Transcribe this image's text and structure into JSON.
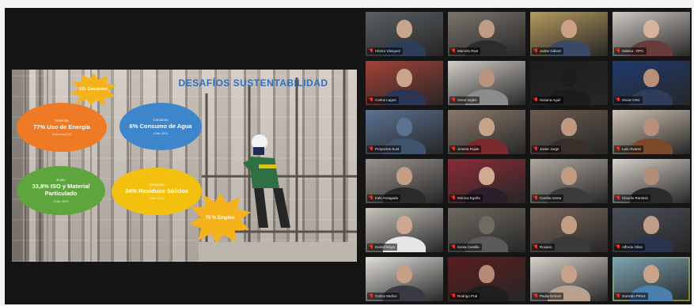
{
  "slide": {
    "title": "DESAFÍOS SUSTENTABILIDAD",
    "bubbles": [
      {
        "id": "orange",
        "cap": "Vivienda",
        "main": "77% Uso de Energía",
        "note": "Consumo (%)"
      },
      {
        "id": "blue",
        "cap": "Consumo",
        "main": "6% Consumo de Agua",
        "note": "Chile 2011"
      },
      {
        "id": "green",
        "cap": "Suelo",
        "main": "33,8% ISO y Material Particulado",
        "note": "Chile 2015"
      },
      {
        "id": "yellow",
        "cap": "Residuos",
        "main": "34% Residuos Sólidos",
        "note": "Chile 2010"
      }
    ],
    "bursts": [
      "CO₂ Emisiones",
      "75 % Empleo"
    ]
  },
  "participants": [
    {
      "name": "Héctor Vásquez",
      "bg": "#5a5f63",
      "skin": "#c9a58c",
      "shirt": "#2d3e5b"
    },
    {
      "name": "Marcelo Rive",
      "bg": "#7b746c",
      "skin": "#c19b84",
      "shirt": "#2c2c2c"
    },
    {
      "name": "Jaime Gálvez",
      "bg": "#b49a5e",
      "skin": "#caa283",
      "shirt": "#3a4a66"
    },
    {
      "name": "Sabina - RPC",
      "bg": "#cfc9c4",
      "skin": "#d7b39c",
      "shirt": "#6a3b3b"
    },
    {
      "name": "Carlos Lagos",
      "bg": "#a44236",
      "skin": "#c9a58a",
      "shirt": "#2b3556"
    },
    {
      "name": "Omar Ingles",
      "bg": "#d2cdc7",
      "skin": "#b9957f",
      "shirt": "#8c8c8c"
    },
    {
      "name": "Susana Aguir",
      "bg": "#1c1c1c",
      "skin": "#1c1c1c",
      "shirt": "#1c1c1c"
    },
    {
      "name": "Oscar Ortiz",
      "bg": "#203a70",
      "skin": "#b88f79",
      "shirt": "#2f3d5a"
    },
    {
      "name": "Proyectos Sust",
      "bg": "#5b7392",
      "skin": "#5b7392",
      "shirt": "#40536d"
    },
    {
      "name": "Jimena Rojas",
      "bg": "#8b7a6c",
      "skin": "#c8a189",
      "shirt": "#7a2a2a"
    },
    {
      "name": "Javier Jorgs",
      "bg": "#6d5c50",
      "skin": "#bf9880",
      "shirt": "#3a2e2a"
    },
    {
      "name": "Luis Alvarez",
      "bg": "#cfc3b2",
      "skin": "#b88f7a",
      "shirt": "#7a4a2a"
    },
    {
      "name": "Inés Arriagada",
      "bg": "#9a948f",
      "skin": "#c59e86",
      "shirt": "#2a2a2a"
    },
    {
      "name": "Mónica Egaña",
      "bg": "#8a2c36",
      "skin": "#d0ab91",
      "shirt": "#2a1f2a"
    },
    {
      "name": "Camila Arena",
      "bg": "#b1a9a0",
      "skin": "#c29a83",
      "shirt": "#3b3b3b"
    },
    {
      "name": "Claudio Ramirez",
      "bg": "#d6d1ca",
      "skin": "#b38d78",
      "shirt": "#2a2a2a"
    },
    {
      "name": "Daniel Moya",
      "bg": "#c8c3bd",
      "skin": "#cda78e",
      "shirt": "#e6e6e6"
    },
    {
      "name": "Sonia Castillo",
      "bg": "#6f6a62",
      "skin": "#6f6a62",
      "shirt": "#5a5a5a"
    },
    {
      "name": "Rosario",
      "bg": "#7d6a5e",
      "skin": "#c69d84",
      "shirt": "#3a3a3a"
    },
    {
      "name": "Alfredo Oliva",
      "bg": "#4a4f58",
      "skin": "#c19c86",
      "shirt": "#2a3450"
    },
    {
      "name": "Carlos Muñoz",
      "bg": "#e2dfda",
      "skin": "#c7a086",
      "shirt": "#3a3a46"
    },
    {
      "name": "Rodrigo Prat",
      "bg": "#5a1d1d",
      "skin": "#b58b76",
      "shirt": "#1f1f1f"
    },
    {
      "name": "Paula Gómez",
      "bg": "#d9d3cc",
      "skin": "#c8a18a",
      "shirt": "#b8a28f"
    },
    {
      "name": "Gonzalo Pérez",
      "bg": "#7ea6b3",
      "skin": "#c9a38b",
      "shirt": "#4a7fae",
      "active": true
    }
  ]
}
